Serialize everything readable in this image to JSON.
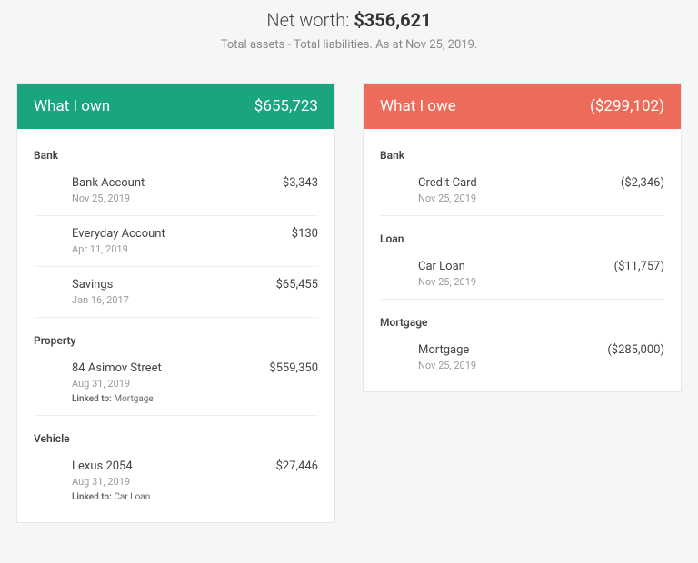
{
  "header": {
    "networth_label": "Net worth: ",
    "networth_value": "$356,621",
    "subtitle": "Total assets - Total liabilities. As at Nov 25, 2019."
  },
  "assets": {
    "title": "What I own",
    "total": "$655,723",
    "groups": [
      {
        "label": "Bank",
        "items": [
          {
            "name": "Bank Account",
            "date": "Nov 25, 2019",
            "value": "$3,343"
          },
          {
            "name": "Everyday Account",
            "date": "Apr 11, 2019",
            "value": "$130"
          },
          {
            "name": "Savings",
            "date": "Jan 16, 2017",
            "value": "$65,455"
          }
        ]
      },
      {
        "label": "Property",
        "items": [
          {
            "name": "84 Asimov Street",
            "date": "Aug 31, 2019",
            "value": "$559,350",
            "linked_label": "Linked to:",
            "linked_to": "Mortgage"
          }
        ]
      },
      {
        "label": "Vehicle",
        "items": [
          {
            "name": "Lexus 2054",
            "date": "Aug 31, 2019",
            "value": "$27,446",
            "linked_label": "Linked to:",
            "linked_to": "Car Loan"
          }
        ]
      }
    ]
  },
  "liabilities": {
    "title": "What I owe",
    "total": "($299,102)",
    "groups": [
      {
        "label": "Bank",
        "items": [
          {
            "name": "Credit Card",
            "date": "Nov 25, 2019",
            "value": "($2,346)"
          }
        ]
      },
      {
        "label": "Loan",
        "items": [
          {
            "name": "Car Loan",
            "date": "Nov 25, 2019",
            "value": "($11,757)"
          }
        ]
      },
      {
        "label": "Mortgage",
        "items": [
          {
            "name": "Mortgage",
            "date": "Nov 25, 2019",
            "value": "($285,000)"
          }
        ]
      }
    ]
  }
}
